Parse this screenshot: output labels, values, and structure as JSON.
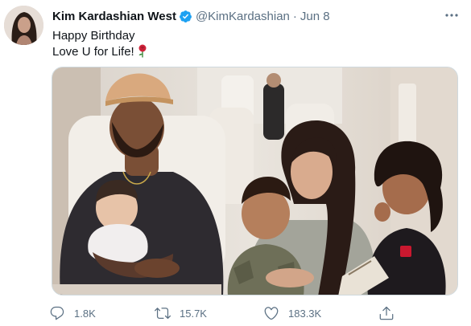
{
  "tweet": {
    "display_name": "Kim Kardashian West",
    "handle": "@KimKardashian",
    "separator": "·",
    "time": "Jun 8",
    "text_lines": [
      "Happy Birthday",
      "Love U for Life!"
    ],
    "emoji": "rose",
    "media_description_icon": "family-photo-on-private-jet",
    "verified_icon": "verified-badge-icon",
    "accent_color": "#1da1f2"
  },
  "actions": {
    "reply": {
      "count": "1.8K",
      "icon": "reply-icon"
    },
    "retweet": {
      "count": "15.7K",
      "icon": "retweet-icon"
    },
    "like": {
      "count": "183.3K",
      "icon": "heart-icon"
    },
    "share": {
      "icon": "share-icon"
    }
  },
  "colors": {
    "text": "#0f1419",
    "secondary": "#5b7083",
    "border": "#cfd9de"
  }
}
